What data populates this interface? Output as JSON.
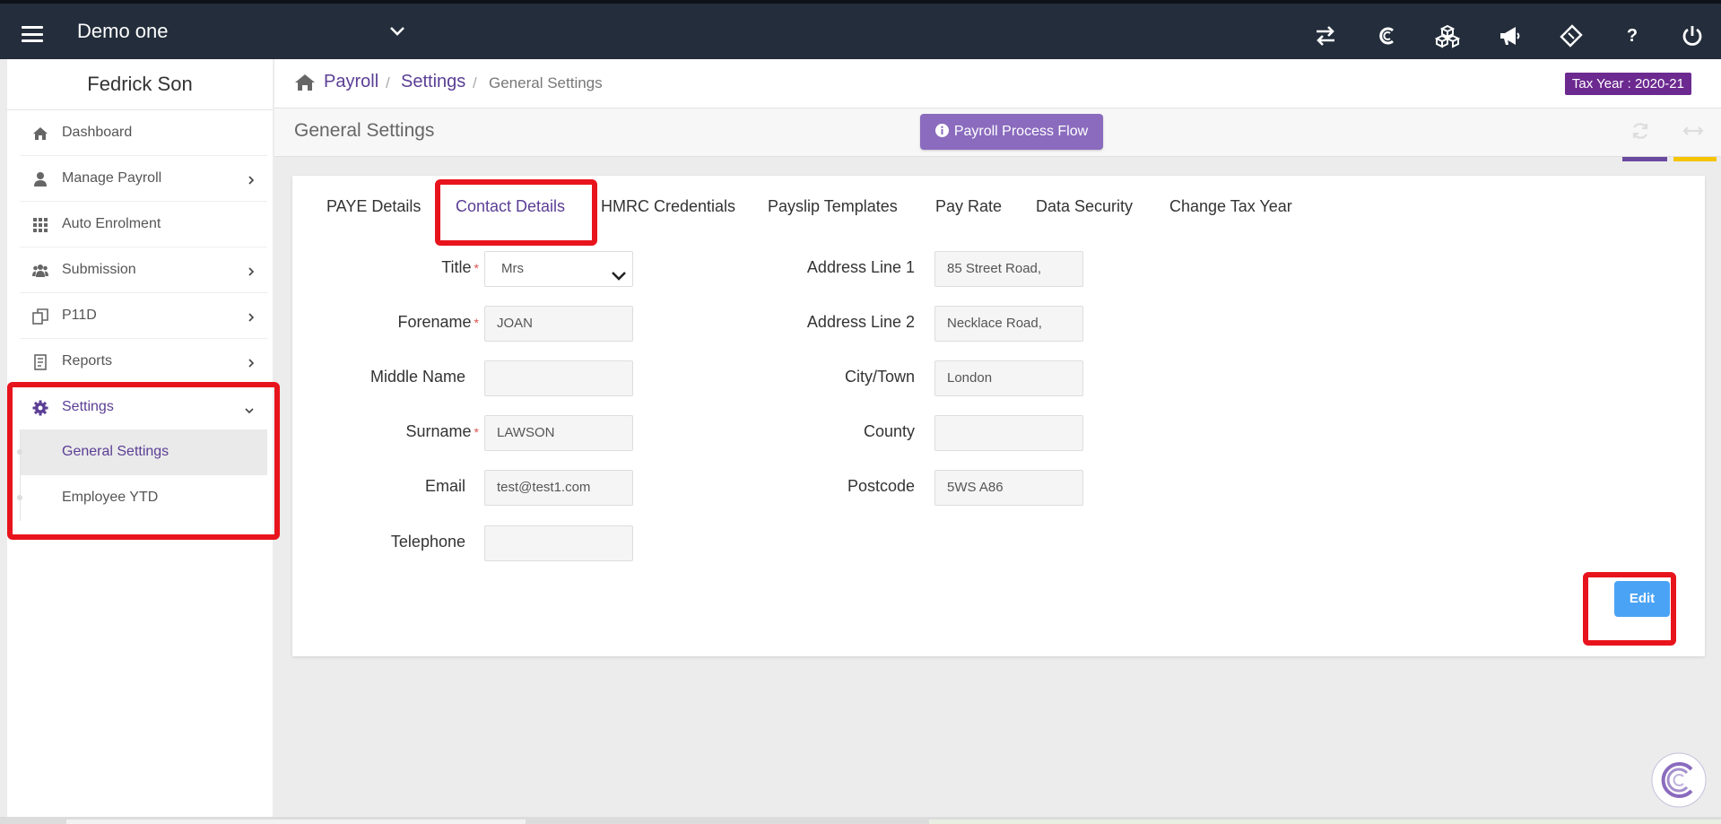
{
  "topbar": {
    "company_name": "Demo one",
    "icons": [
      "transfer-icon",
      "currency-icon",
      "cubes-icon",
      "megaphone-icon",
      "ticket-icon",
      "help-icon",
      "power-icon"
    ],
    "help_glyph": "?",
    "background": "#232d3b"
  },
  "sidebar": {
    "user_name": "Fedrick Son",
    "items": [
      {
        "label": "Dashboard",
        "icon": "home-icon",
        "has_arrow": false
      },
      {
        "label": "Manage Payroll",
        "icon": "user-icon",
        "has_arrow": true
      },
      {
        "label": "Auto Enrolment",
        "icon": "grid-icon",
        "has_arrow": false
      },
      {
        "label": "Submission",
        "icon": "users-icon",
        "has_arrow": true
      },
      {
        "label": "P11D",
        "icon": "copy-icon",
        "has_arrow": true
      },
      {
        "label": "Reports",
        "icon": "report-icon",
        "has_arrow": true
      },
      {
        "label": "Settings",
        "icon": "gear-icon",
        "expanded": true
      }
    ],
    "sub_items": [
      {
        "label": "General Settings",
        "selected": true
      },
      {
        "label": "Employee YTD",
        "selected": false
      }
    ]
  },
  "breadcrumb": {
    "items": [
      "Payroll",
      "Settings"
    ],
    "separator": "/",
    "current": "General Settings"
  },
  "tax_year": "Tax Year : 2020-21",
  "header": {
    "title": "General Settings",
    "process_flow_label": "Payroll Process Flow"
  },
  "tabs": [
    "PAYE Details",
    "Contact Details",
    "HMRC Credentials",
    "Payslip Templates",
    "Pay Rate",
    "Data Security",
    "Change Tax Year"
  ],
  "active_tab": "Contact Details",
  "form": {
    "left": [
      {
        "label": "Title",
        "value": "Mrs",
        "required": true,
        "type": "select"
      },
      {
        "label": "Forename",
        "value": "JOAN",
        "required": true
      },
      {
        "label": "Middle Name",
        "value": "",
        "required": false
      },
      {
        "label": "Surname",
        "value": "LAWSON",
        "required": true
      },
      {
        "label": "Email",
        "value": "test@test1.com",
        "required": false
      },
      {
        "label": "Telephone",
        "value": "",
        "required": false
      }
    ],
    "right": [
      {
        "label": "Address Line 1",
        "value": "85 Street Road,"
      },
      {
        "label": "Address Line 2",
        "value": "Necklace Road,"
      },
      {
        "label": "City/Town",
        "value": "London"
      },
      {
        "label": "County",
        "value": ""
      },
      {
        "label": "Postcode",
        "value": "5WS A86"
      }
    ],
    "required_mark": "*",
    "edit_label": "Edit"
  },
  "colors": {
    "accent_purple": "#5b3e95",
    "tax_badge": "#6c2a90",
    "process_button": "#8a6bbe",
    "edit_button": "#4aa3f5",
    "annotation_red": "#e8141d",
    "header_line_purple": "#6a4aa0",
    "header_line_yellow": "#f5c400"
  }
}
